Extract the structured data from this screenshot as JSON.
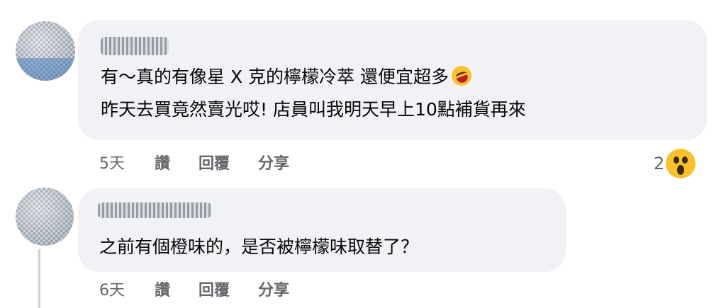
{
  "comments": [
    {
      "lines": [
        "有～真的有像星 X 克的檸檬冷萃 還便宜超多",
        "昨天去買竟然賣光哎! 店員叫我明天早上10點補貨再來"
      ],
      "emoji": "laughing-face-icon",
      "time": "5天",
      "like": "讚",
      "reply": "回覆",
      "share": "分享",
      "reaction_count": "2",
      "reaction_icon": "wow-face-icon"
    },
    {
      "lines": [
        "之前有個橙味的，是否被檸檬味取替了？"
      ],
      "time": "6天",
      "like": "讚",
      "reply": "回覆",
      "share": "分享"
    }
  ],
  "colors": {
    "bubble_bg": "#f0f2f5",
    "meta_text": "#65676b",
    "emoji_yellow": "#f7c12f"
  }
}
